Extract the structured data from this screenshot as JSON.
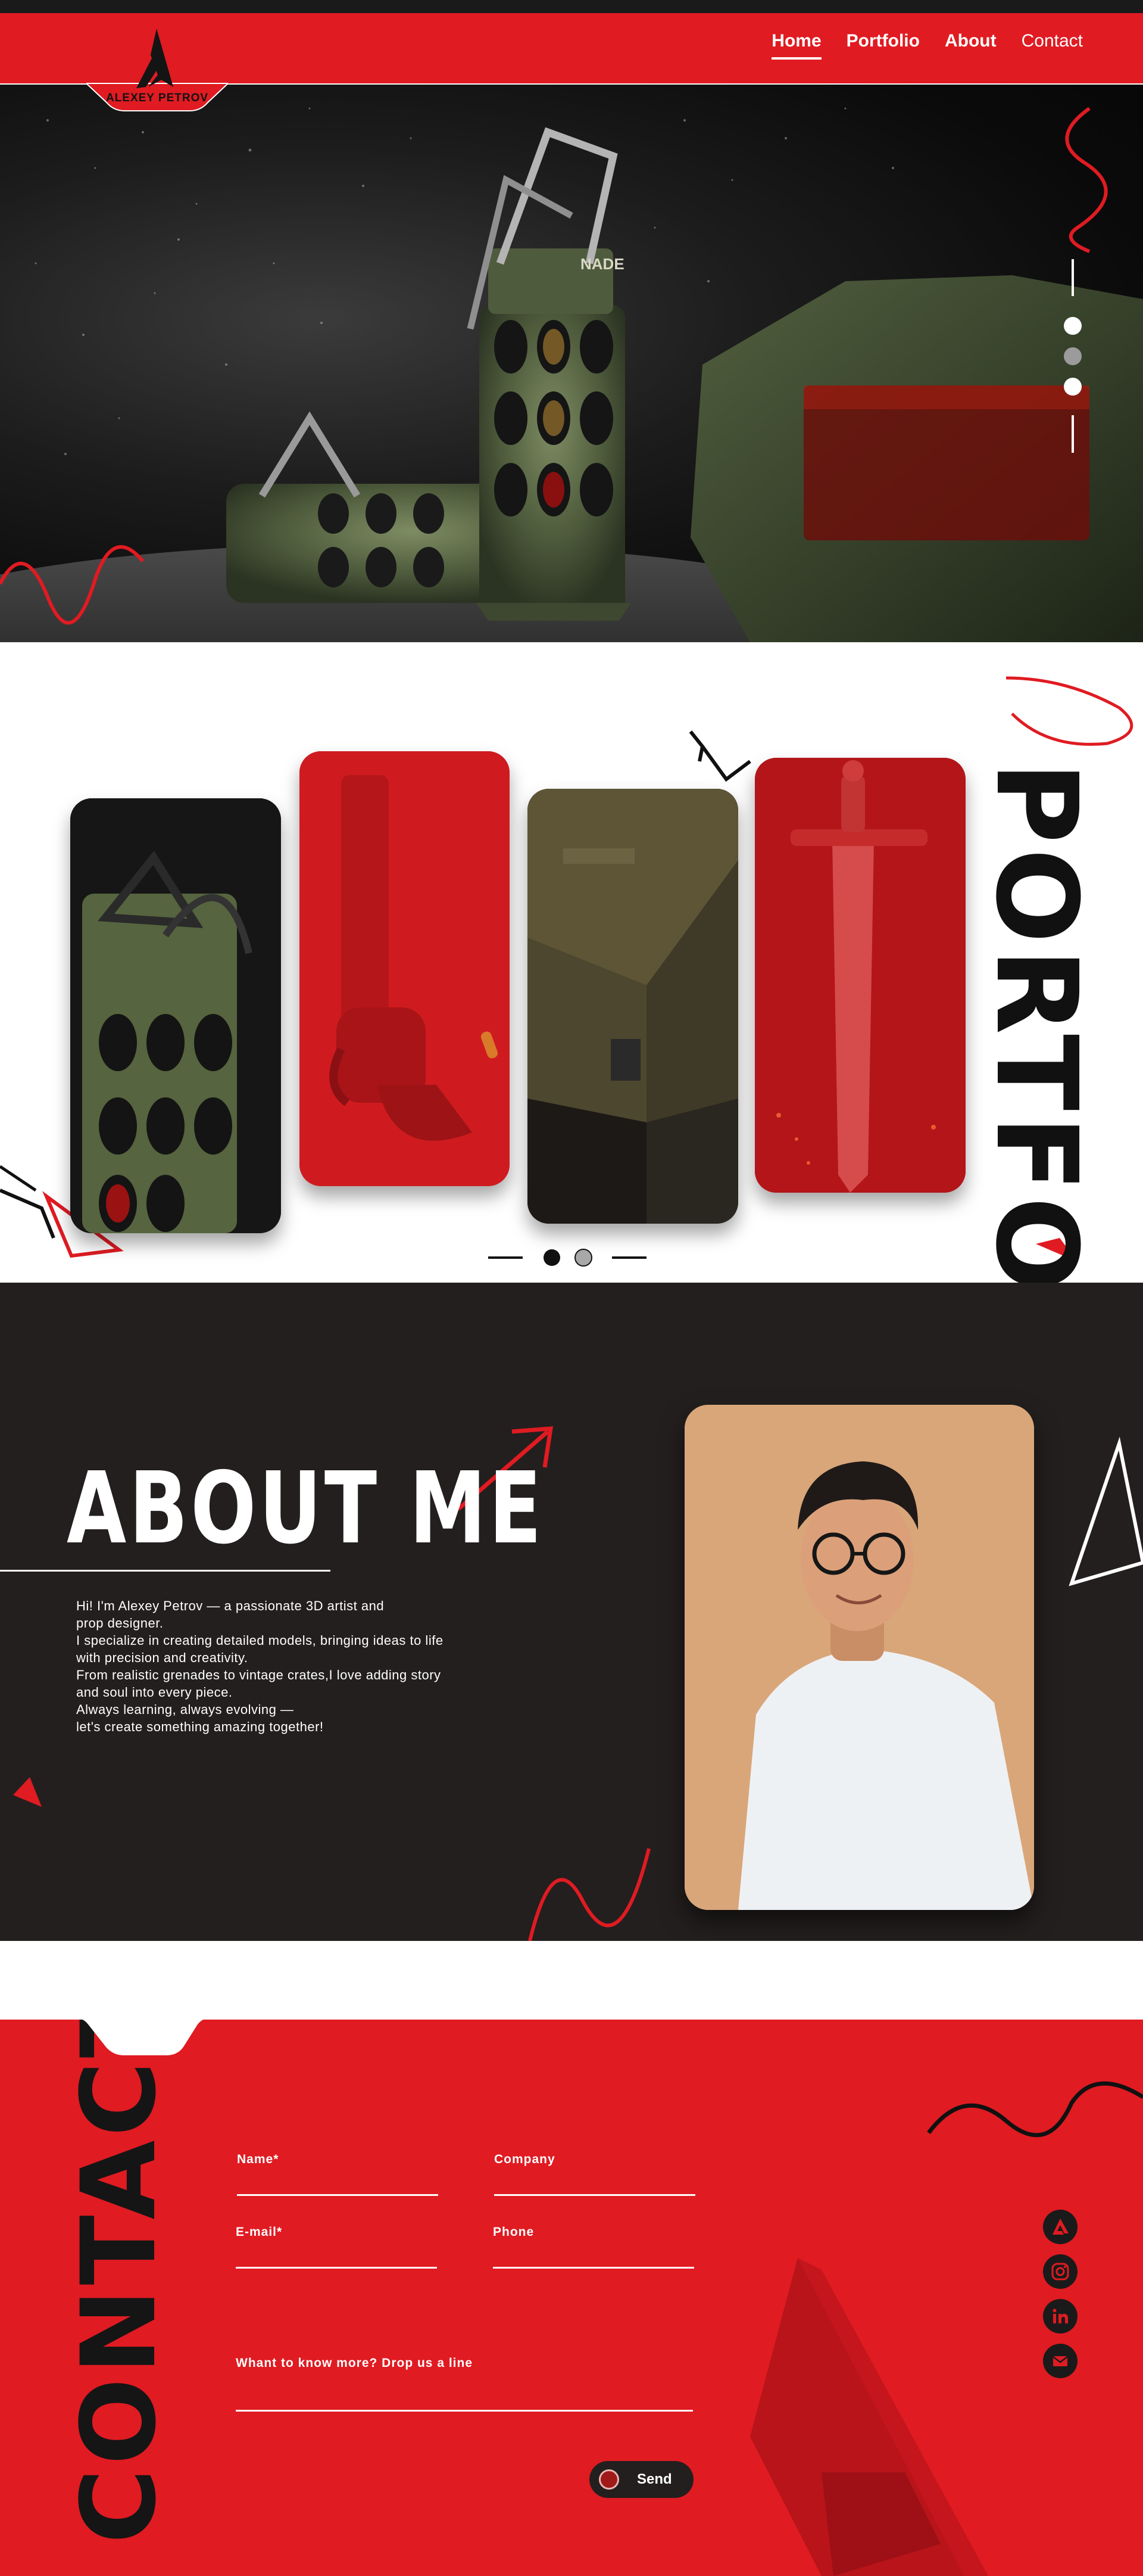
{
  "brand": {
    "name": "ALEXEY PETROV"
  },
  "nav": {
    "items": [
      {
        "label": "Home"
      },
      {
        "label": "Portfolio"
      },
      {
        "label": "About"
      },
      {
        "label": "Contact"
      }
    ],
    "active": "Home"
  },
  "hero": {
    "image": "grenade-render",
    "grenade_label": "NADE",
    "slides_total": 3,
    "active_slide": 2
  },
  "portfolio": {
    "title": "PORTFOLIO",
    "cards": [
      {
        "image": "grenade-closeup"
      },
      {
        "image": "revolver-on-red"
      },
      {
        "image": "wooden-ammo-crate"
      },
      {
        "image": "sword-on-red"
      }
    ],
    "pages_total": 2,
    "active_page": 1
  },
  "about": {
    "title": "ABOUT ME",
    "paragraphs": [
      "Hi! I'm Alexey Petrov — a passionate 3D artist and",
      "prop designer.",
      "I specialize in creating detailed models, bringing ideas to life",
      "with precision and creativity.",
      "From realistic grenades to vintage crates,I love adding story",
      "and soul into every piece.",
      "Always learning, always evolving —",
      "let's create something amazing together!"
    ],
    "photo": "portrait-photo"
  },
  "contact": {
    "title": "CONTACT",
    "fields": {
      "name": "Name*",
      "company": "Company",
      "email": "E-mail*",
      "phone": "Phone",
      "message": "Whant to know more? Drop us a line"
    },
    "send_label": "Send",
    "social": [
      "artstation-icon",
      "instagram-icon",
      "linkedin-icon",
      "mail-icon"
    ]
  },
  "colors": {
    "accent": "#e01b22",
    "dark": "#231f1e",
    "text_light": "#ffffff"
  }
}
